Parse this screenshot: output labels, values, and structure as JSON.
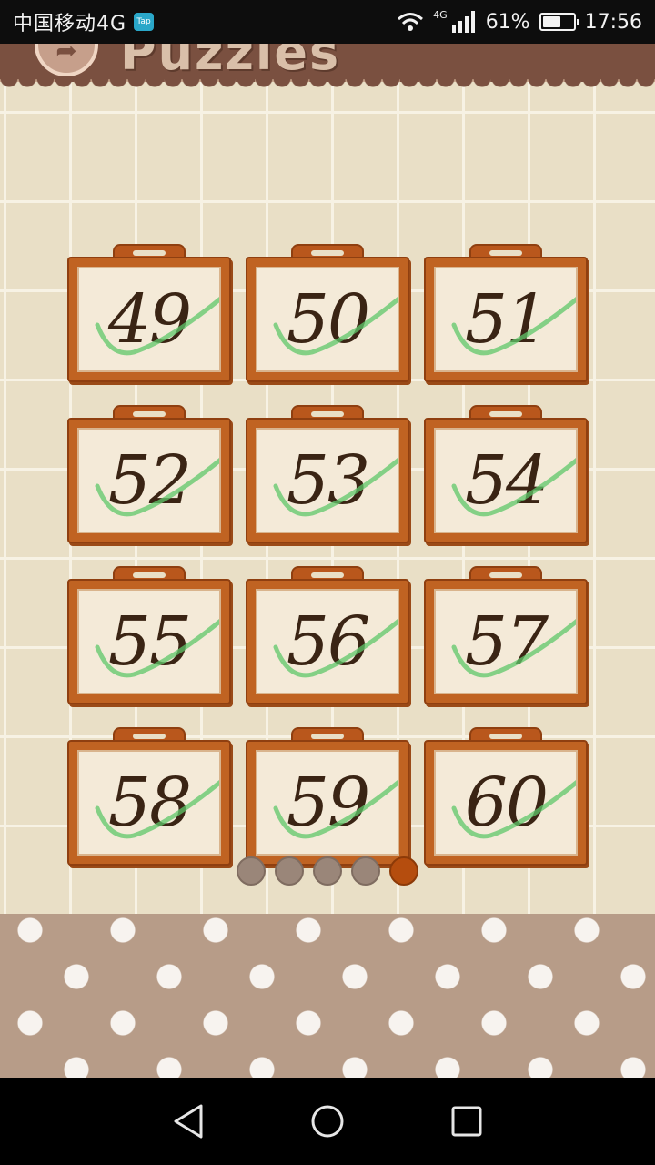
{
  "status_bar": {
    "carrier": "中国移动4G",
    "tap_badge": "Tap",
    "network": "4G",
    "battery_percent": "61%",
    "battery_level": 0.61,
    "time": "17:56",
    "icons": [
      "wifi-icon",
      "signal-icon",
      "battery-icon"
    ]
  },
  "header": {
    "title": "Puzzles",
    "back_icon": "back-arrow-icon"
  },
  "puzzles": [
    {
      "number": "49",
      "completed": true
    },
    {
      "number": "50",
      "completed": true
    },
    {
      "number": "51",
      "completed": true
    },
    {
      "number": "52",
      "completed": true
    },
    {
      "number": "53",
      "completed": true
    },
    {
      "number": "54",
      "completed": true
    },
    {
      "number": "55",
      "completed": true
    },
    {
      "number": "56",
      "completed": true
    },
    {
      "number": "57",
      "completed": true
    },
    {
      "number": "58",
      "completed": true
    },
    {
      "number": "59",
      "completed": true
    },
    {
      "number": "60",
      "completed": true
    }
  ],
  "pager": {
    "total_pages": 5,
    "current_page": 5
  },
  "colors": {
    "header": "#7a5040",
    "card_frame": "#c06322",
    "check": "#5fc76a",
    "active_dot": "#b54d0e",
    "inactive_dot": "#9a8679"
  },
  "nav": {
    "icons": [
      "back-triangle-icon",
      "home-circle-icon",
      "recents-square-icon"
    ]
  }
}
